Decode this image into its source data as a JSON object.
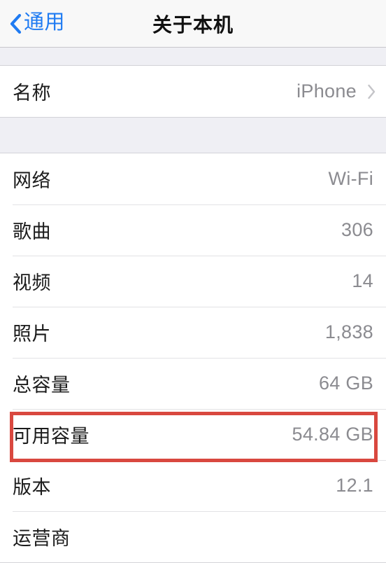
{
  "navbar": {
    "back_label": "通用",
    "back_icon": "chevron-left-icon",
    "title": "关于本机"
  },
  "sections": [
    {
      "rows": [
        {
          "label": "名称",
          "value": "iPhone",
          "chevron": true,
          "chevron_icon": "chevron-right-icon"
        }
      ]
    },
    {
      "rows": [
        {
          "label": "网络",
          "value": "Wi-Fi",
          "chevron": false
        },
        {
          "label": "歌曲",
          "value": "306",
          "chevron": false
        },
        {
          "label": "视频",
          "value": "14",
          "chevron": false
        },
        {
          "label": "照片",
          "value": "1,838",
          "chevron": false
        },
        {
          "label": "总容量",
          "value": "64 GB",
          "chevron": false
        },
        {
          "label": "可用容量",
          "value": "54.84 GB",
          "chevron": false
        },
        {
          "label": "版本",
          "value": "12.1",
          "chevron": false
        },
        {
          "label": "运营商",
          "value": "",
          "chevron": false
        }
      ]
    }
  ],
  "annotation": {
    "target_label": "可用容量",
    "color": "#d9483f"
  },
  "colors": {
    "accent_blue": "#1f7bf2",
    "label_text": "#1b1b1b",
    "value_text": "#8b8b90",
    "page_background": "#efeff4",
    "row_background": "#ffffff",
    "separator": "#e2e2e5",
    "navbar_background": "#f8f8f8"
  }
}
